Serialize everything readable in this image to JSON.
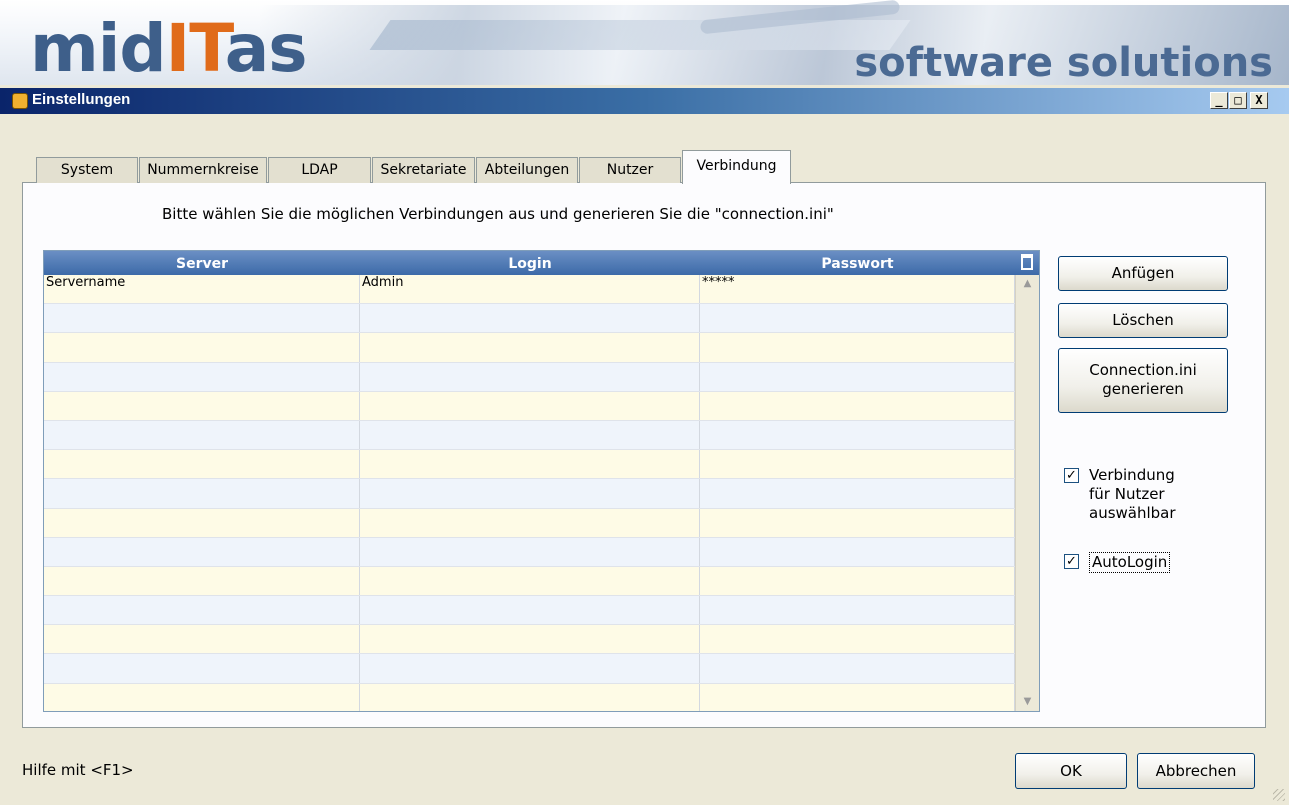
{
  "banner": {
    "logo_mid": "mid",
    "logo_it": "IT",
    "logo_tas": "as",
    "tagline": "software solutions"
  },
  "window": {
    "title": "Einstellungen",
    "minimize": "_",
    "maximize": "□",
    "close": "X"
  },
  "tabs": [
    {
      "label": "System"
    },
    {
      "label": "Nummernkreise"
    },
    {
      "label": "LDAP"
    },
    {
      "label": "Sekretariate"
    },
    {
      "label": "Abteilungen"
    },
    {
      "label": "Nutzer"
    },
    {
      "label": "Verbindung",
      "active": true
    }
  ],
  "main": {
    "hint": "Bitte wählen Sie die möglichen Verbindungen aus und generieren Sie die \"connection.ini\""
  },
  "grid": {
    "columns": [
      "Server",
      "Login",
      "Passwort"
    ],
    "rows": [
      [
        "Servername",
        "Admin",
        "*****"
      ],
      [
        "",
        "",
        ""
      ],
      [
        "",
        "",
        ""
      ],
      [
        "",
        "",
        ""
      ],
      [
        "",
        "",
        ""
      ],
      [
        "",
        "",
        ""
      ],
      [
        "",
        "",
        ""
      ],
      [
        "",
        "",
        ""
      ],
      [
        "",
        "",
        ""
      ],
      [
        "",
        "",
        ""
      ],
      [
        "",
        "",
        ""
      ],
      [
        "",
        "",
        ""
      ],
      [
        "",
        "",
        ""
      ],
      [
        "",
        "",
        ""
      ],
      [
        "",
        "",
        ""
      ]
    ]
  },
  "buttons": {
    "add": "Anfügen",
    "delete": "Löschen",
    "generate_line1": "Connection.ini",
    "generate_line2": "generieren",
    "ok": "OK",
    "cancel": "Abbrechen"
  },
  "options": {
    "selectable_line1": "Verbindung",
    "selectable_line2": "für Nutzer",
    "selectable_line3": "auswählbar",
    "selectable_checked": true,
    "autologin": "AutoLogin",
    "autologin_checked": true
  },
  "footer": {
    "help": "Hilfe mit <F1>"
  }
}
